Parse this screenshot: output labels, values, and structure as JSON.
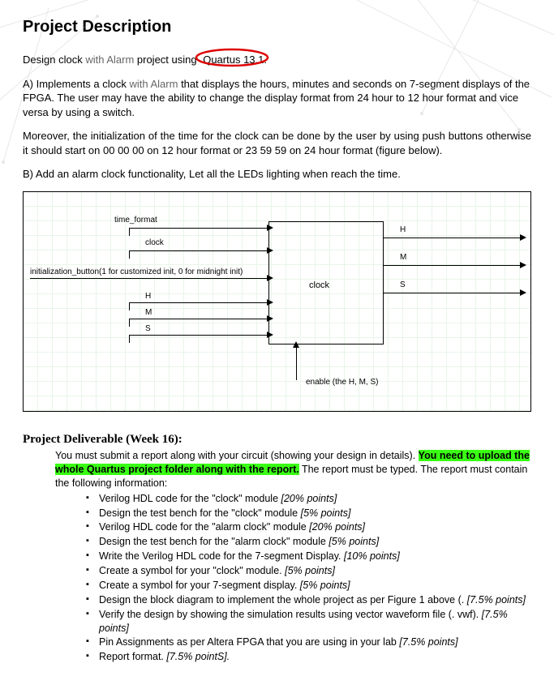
{
  "title": "Project Description",
  "intro": {
    "prefix": "Design clock",
    "with_alarm": " with Alarm ",
    "suffix": "project using ",
    "circled": "Quartus 13.1."
  },
  "section_a": {
    "lead": "A) Implements a clock",
    "grey": " with Alarm ",
    "rest": "that displays the hours, minutes and seconds on 7-segment displays of the FPGA. The user may have the ability to change the display format from 24 hour to 12 hour format and vice versa by using a switch."
  },
  "moreover": "Moreover, the initialization of the time for the clock can be done by the user by using push buttons otherwise it should start on 00 00 00 on 12 hour format or 23 59 59 on 24 hour format (figure below).",
  "section_b": "B) Add an alarm clock functionality, Let all the LEDs lighting when reach the time.",
  "diagram": {
    "time_format": "time_format",
    "clock_in": "clock",
    "init_button": "initialization_button(1 for customized init, 0 for midnight init)",
    "H": "H",
    "M": "M",
    "S": "S",
    "center": "clock",
    "enable": "enable (the H, M, S)",
    "out_H": "H",
    "out_M": "M",
    "out_S": "S"
  },
  "deliverable": {
    "heading": "Project Deliverable (Week 16):",
    "body_prefix": "You must submit a report along with your circuit (showing your design in details). ",
    "highlight": "You need to upload the whole Quartus project folder along with the report.",
    "body_suffix": " The report must be typed. The report must contain the following information:",
    "items": [
      {
        "text": "Verilog HDL code for the \"clock\" module ",
        "points": "[20% points]"
      },
      {
        "text": "Design the test bench for the \"clock\" module ",
        "points": "[5% points]"
      },
      {
        "text": "Verilog HDL code for the \"alarm clock\" module ",
        "points": "[20% points]"
      },
      {
        "text": "Design the test bench for the \"alarm clock\" module ",
        "points": "[5% points]"
      },
      {
        "text": "Write the Verilog HDL code for the 7-segment Display. ",
        "points": "[10% points]"
      },
      {
        "text": "Create a symbol for your \"clock\" module. ",
        "points": "[5% points]"
      },
      {
        "text": "Create a symbol for your 7-segment display. ",
        "points": "[5% points]"
      },
      {
        "text": "Design the block diagram to implement the whole project as per Figure 1 above (. ",
        "points": "[7.5% points]"
      },
      {
        "text": "Verify the design by showing the simulation results using vector waveform file (. vwf). ",
        "points": "[7.5% points]"
      },
      {
        "text": "Pin Assignments as per Altera FPGA that you are using in your lab ",
        "points": "[7.5% points]"
      },
      {
        "text": "Report format. ",
        "points": "[7.5% pointS]."
      }
    ]
  }
}
